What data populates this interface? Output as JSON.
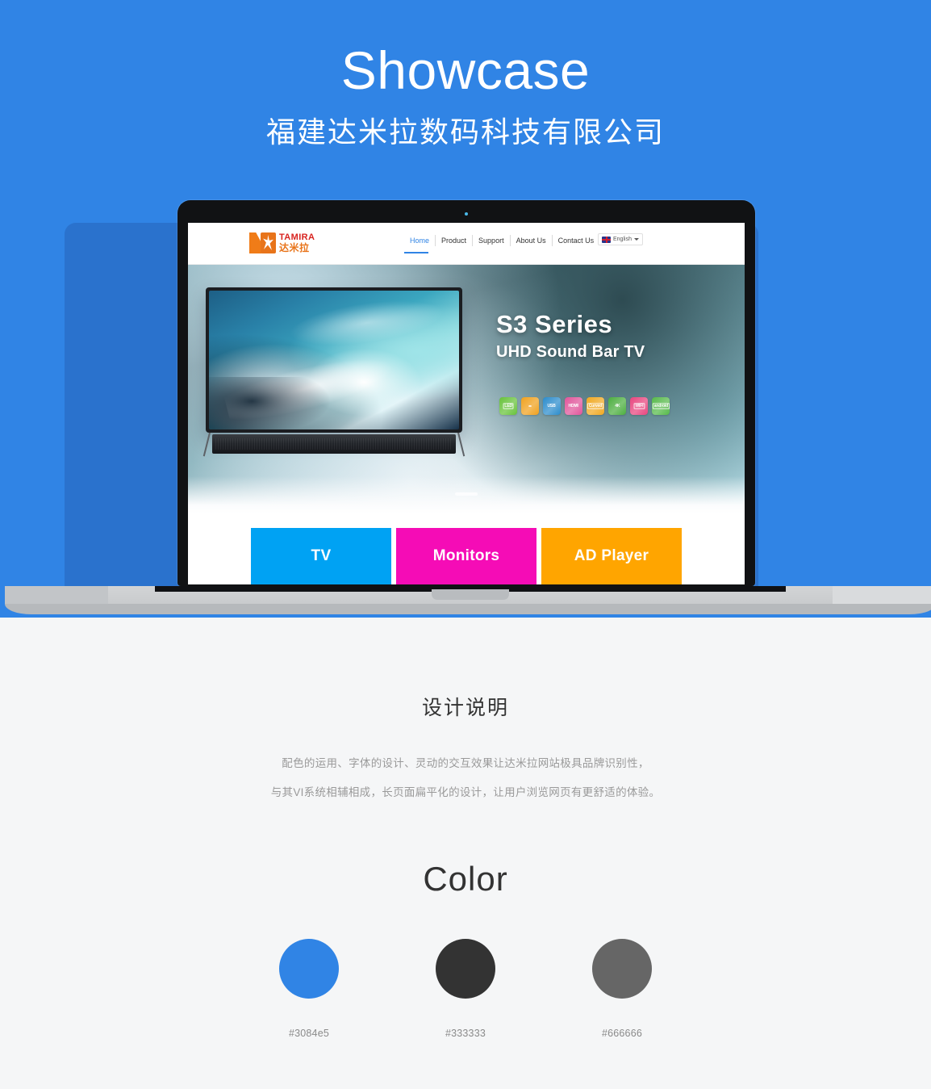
{
  "header": {
    "title": "Showcase",
    "subtitle": "福建达米拉数码科技有限公司",
    "band_color": "#3084e5"
  },
  "mockup": {
    "device": "laptop",
    "site": {
      "logo": {
        "mark_icon": "tamira-logo-icon",
        "brand_en": "TAMIRA",
        "brand_cn": "达米拉"
      },
      "nav": [
        {
          "label": "Home",
          "active": true
        },
        {
          "label": "Product",
          "active": false
        },
        {
          "label": "Support",
          "active": false
        },
        {
          "label": "About Us",
          "active": false
        },
        {
          "label": "Contact Us",
          "active": false
        }
      ],
      "language": {
        "flag_icon": "uk-flag-icon",
        "label": "English",
        "caret_icon": "chevron-down-icon"
      },
      "banner": {
        "title": "S3 Series",
        "subtitle": "UHD Sound Bar TV",
        "product_image": "tv-with-ocean-wave-wallpaper",
        "badges": [
          {
            "label": "LED",
            "color": "#67c23a"
          },
          {
            "label": "",
            "color": "#f0a11e",
            "icon": "device-connector-icon"
          },
          {
            "label": "USB",
            "color": "#2b8ccc"
          },
          {
            "label": "HDMI",
            "color": "#e0549a"
          },
          {
            "label": "Curved",
            "color": "#f0a820"
          },
          {
            "label": "4K",
            "color": "#4cae3f"
          },
          {
            "label": "WIFI",
            "color": "#e8457e"
          },
          {
            "label": "android",
            "color": "#56b94a"
          }
        ],
        "carousel_indicator": "active-slide-1"
      },
      "tiles": [
        {
          "label": "TV",
          "color": "#00a2f3"
        },
        {
          "label": "Monitors",
          "color": "#f50cb6"
        },
        {
          "label": "AD Player",
          "color": "#ffa500"
        }
      ]
    }
  },
  "design": {
    "heading": "设计说明",
    "lines": [
      "配色的运用、字体的设计、灵动的交互效果让达米拉网站极具品牌识别性，",
      "与其VI系统相辅相成，长页面扁平化的设计，让用户浏览网页有更舒适的体验。"
    ]
  },
  "color_section": {
    "heading": "Color",
    "swatches": [
      {
        "hex": "#3084e5",
        "label": "#3084e5"
      },
      {
        "hex": "#333333",
        "label": "#333333"
      },
      {
        "hex": "#666666",
        "label": "#666666"
      }
    ]
  }
}
